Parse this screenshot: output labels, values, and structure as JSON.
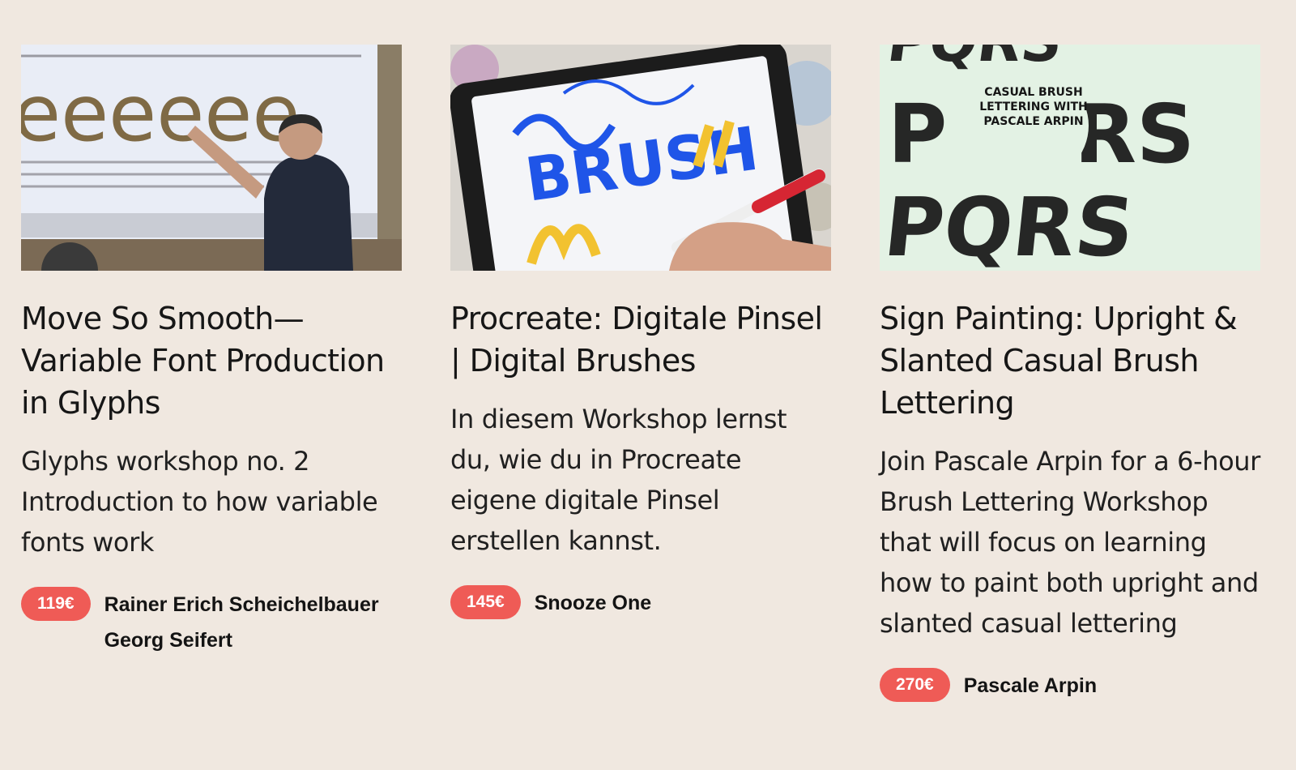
{
  "colors": {
    "background": "#f0e8e0",
    "price_badge": "#ef5b56",
    "text": "#1b1b1b"
  },
  "courses": [
    {
      "image_logo_text": "eeeeee",
      "title": "Move So Smooth—Variable Font Production in Glyphs",
      "description": "Glyphs workshop no. 2 Introduction to how variable fonts work",
      "price": "119€",
      "authors": [
        "Rainer Erich Scheichelbauer",
        "Georg Seifert"
      ]
    },
    {
      "image_logo_text": "BRUSH",
      "title": "Procreate: Digitale Pinsel | Digital Brushes",
      "description": "In diesem Workshop lernst du, wie du in Procreate eigene digitale Pinsel erstellen kannst.",
      "price": "145€",
      "authors": [
        "Snooze One"
      ]
    },
    {
      "image_logo_text": "CASUAL BRUSH LETTERING WITH PASCALE ARPIN",
      "title": "Sign Painting: Upright & Slanted Casual Brush Lettering",
      "description": "Join Pascale Arpin for a 6-hour Brush Lettering Workshop that will focus on learning how to paint both upright and slanted casual lettering",
      "price": "270€",
      "authors": [
        "Pascale Arpin"
      ]
    }
  ]
}
